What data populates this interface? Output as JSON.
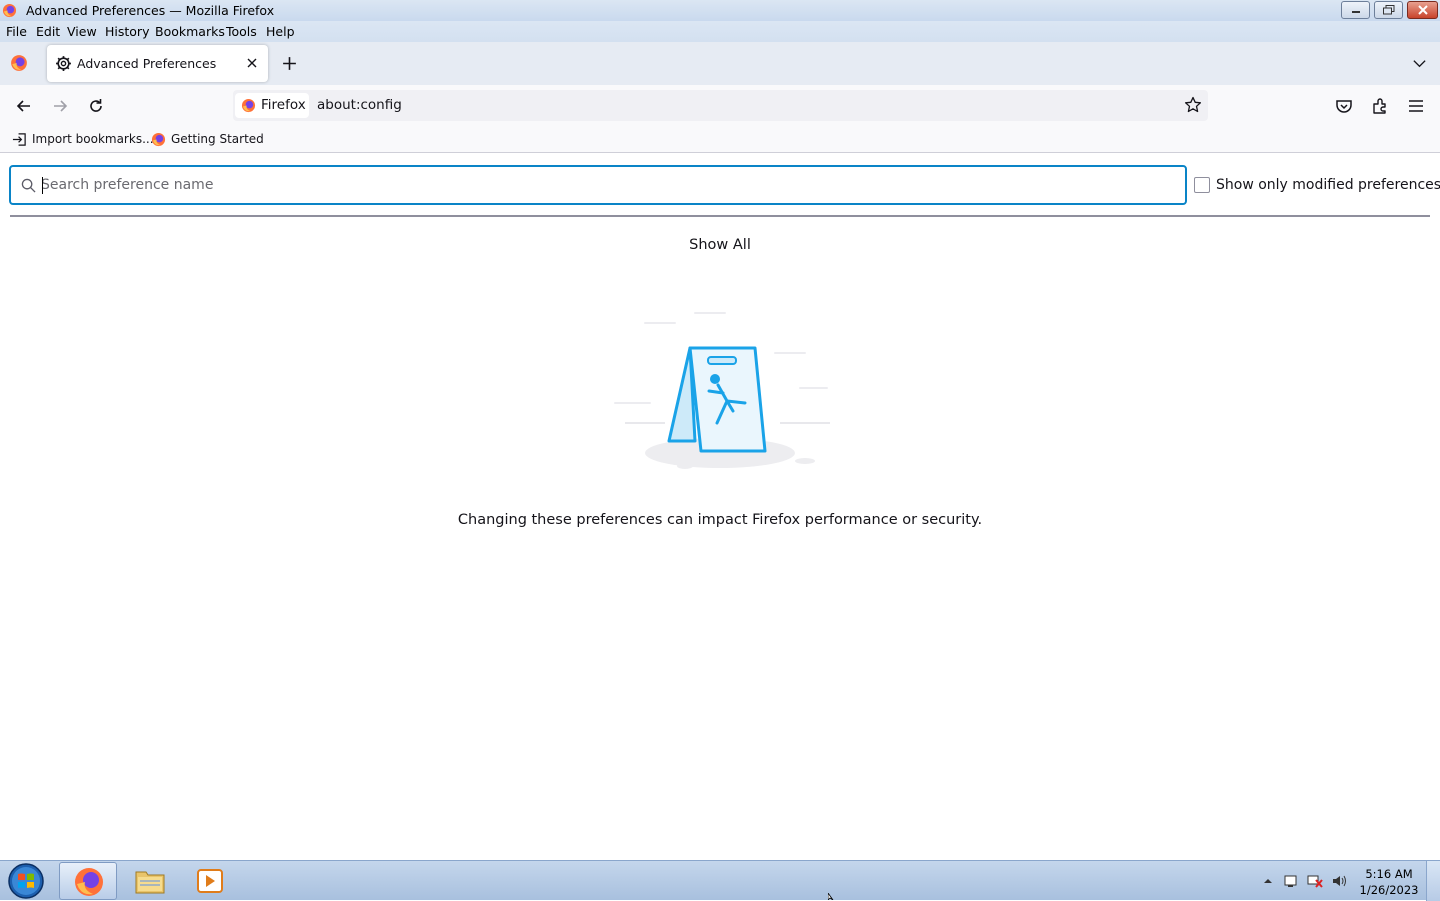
{
  "window": {
    "title": "Advanced Preferences — Mozilla Firefox"
  },
  "menubar": {
    "items": [
      "File",
      "Edit",
      "View",
      "History",
      "Bookmarks",
      "Tools",
      "Help"
    ]
  },
  "tabs": [
    {
      "label": "Advanced Preferences",
      "icon": "gear-icon",
      "active": true
    }
  ],
  "navbar": {
    "identity_label": "Firefox",
    "url": "about:config"
  },
  "bookmarks": [
    {
      "label": "Import bookmarks...",
      "icon": "import-icon"
    },
    {
      "label": "Getting Started",
      "icon": "firefox-icon"
    }
  ],
  "content": {
    "search_placeholder": "Search preference name",
    "search_value": "",
    "modified_only_label": "Show only modified preferences",
    "modified_only_checked": false,
    "show_all_label": "Show All",
    "warning_text": "Changing these preferences can impact Firefox performance or security."
  },
  "taskbar": {
    "time": "5:16 AM",
    "date": "1/26/2023",
    "apps": [
      "firefox",
      "file-explorer",
      "media-player"
    ]
  },
  "colors": {
    "accent": "#0a84c7",
    "illustration_blue": "#1aa3e8"
  }
}
